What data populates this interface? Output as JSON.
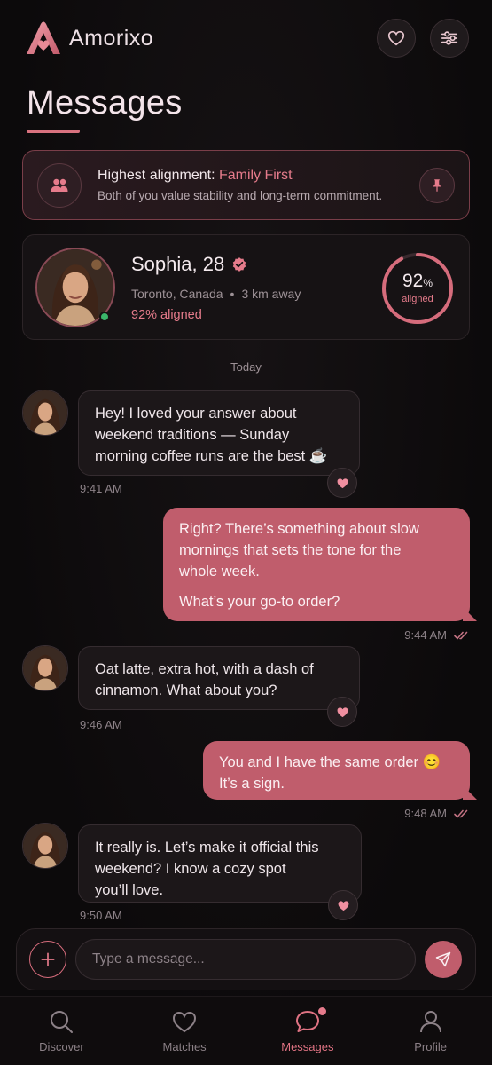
{
  "app": {
    "name": "Amorixo",
    "brand_color": "#d66c7c",
    "bg_color": "#0c0a0b"
  },
  "header": {
    "title": "Messages",
    "actions": [
      {
        "icon": "heart-icon"
      },
      {
        "icon": "sliders-icon"
      }
    ]
  },
  "banner": {
    "prefix": "Highest alignment: ",
    "value": "Family First",
    "description": "Both of you value stability and long-term commitment.",
    "icon": "people-icon",
    "action_icon": "pin-icon"
  },
  "profile": {
    "name": "Sophia, 28",
    "verified": true,
    "location": "Toronto, Canada",
    "distance": "3 km away",
    "aligned_text": "92% aligned",
    "alignment_value": "92",
    "alignment_unit": "%",
    "alignment_label": "aligned",
    "alignment_fraction": 0.92,
    "online": true
  },
  "divider": {
    "label": "Today"
  },
  "messages": [
    {
      "from": "them",
      "lines": [
        "Hey! I loved your answer about",
        "weekend traditions — Sunday",
        "morning coffee runs are the best ☕"
      ],
      "time": "9:41 AM",
      "liked": true
    },
    {
      "from": "me",
      "lines": [
        "Right? There’s something about slow",
        "mornings that sets the tone for the",
        "whole week."
      ],
      "extra": "What’s your go-to order?",
      "time": "9:44 AM",
      "read": true
    },
    {
      "from": "them",
      "lines": [
        "Oat latte, extra hot, with a dash of",
        "cinnamon. What about you?"
      ],
      "time": "9:46 AM",
      "liked": true
    },
    {
      "from": "me",
      "lines": [
        "You and I have the same order 😊",
        "It’s a sign."
      ],
      "time": "9:48 AM",
      "read": true
    },
    {
      "from": "them",
      "lines": [
        "It really is. Let’s make it official this",
        "weekend? I know a cozy spot",
        "you’ll love."
      ],
      "time": "9:50 AM",
      "liked": true
    }
  ],
  "composer": {
    "placeholder": "Type a message..."
  },
  "nav": {
    "items": [
      {
        "label": "Discover",
        "icon": "search-icon"
      },
      {
        "label": "Matches",
        "icon": "heart-icon"
      },
      {
        "label": "Messages",
        "icon": "chat-icon",
        "active": true,
        "has_badge": true
      },
      {
        "label": "Profile",
        "icon": "user-icon"
      }
    ]
  }
}
